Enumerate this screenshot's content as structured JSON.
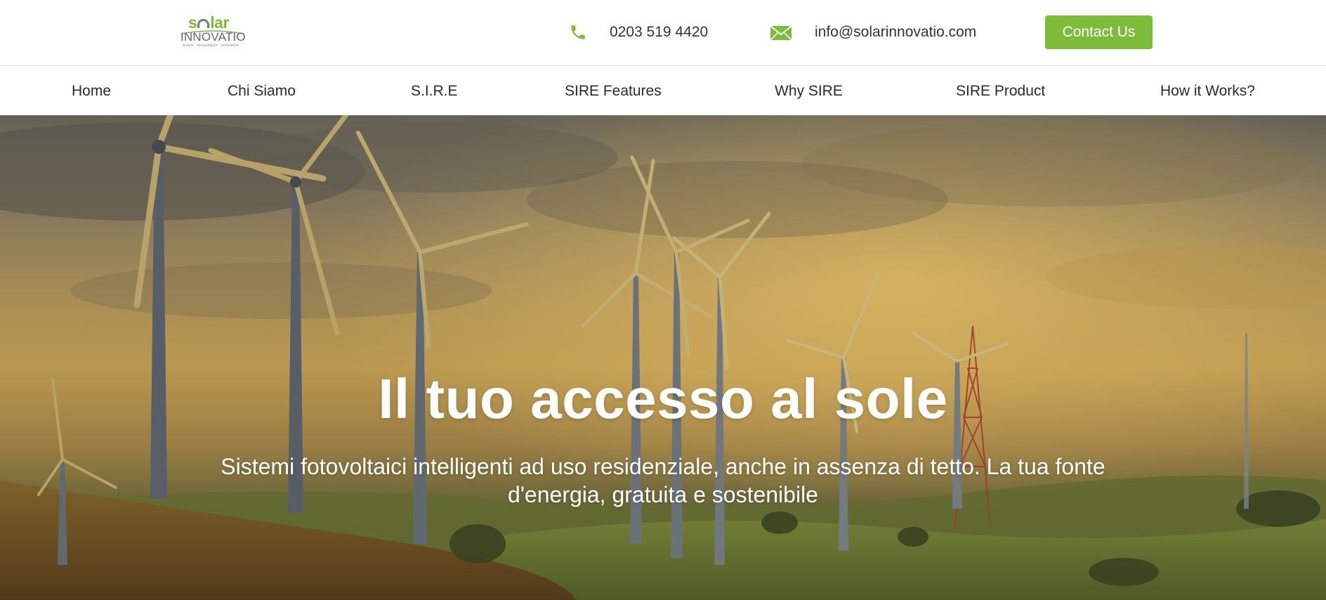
{
  "brand": {
    "logo_top": "solar",
    "logo_mid": "INNOVATIO",
    "logo_sub": "solare · fotovoltaico · innovativo",
    "accent_color": "#7dbb3a"
  },
  "header": {
    "phone": "0203 519 4420",
    "email": "info@solarinnovatio.com",
    "contact_label": "Contact Us",
    "phone_icon": "phone-icon",
    "email_icon": "envelope-icon"
  },
  "nav": {
    "items": [
      {
        "label": "Home"
      },
      {
        "label": "Chi Siamo"
      },
      {
        "label": "S.I.R.E"
      },
      {
        "label": "SIRE Features"
      },
      {
        "label": "Why SIRE"
      },
      {
        "label": "SIRE Product"
      },
      {
        "label": "How it Works?"
      }
    ]
  },
  "hero": {
    "title": "Il tuo accesso al sole",
    "subtitle": "Sistemi fotovoltaici intelligenti ad uso residenziale, anche in assenza di tetto. La tua fonte d'energia, gratuita e sostenibile"
  }
}
